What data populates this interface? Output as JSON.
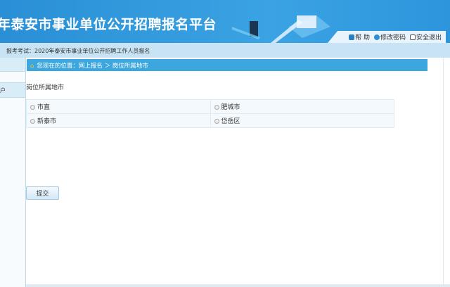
{
  "header": {
    "title": "年泰安市事业单位公开招聘报名平台",
    "links": [
      {
        "label": "帮 助",
        "icon": "lock-icon"
      },
      {
        "label": "修改密码",
        "icon": "help-icon"
      },
      {
        "label": "安全退出",
        "icon": "exit-icon"
      }
    ]
  },
  "exam": {
    "text": "报考考试：2020年泰安市事业单位公开招聘工作人员报名"
  },
  "sidebar": {
    "items": [
      {
        "label": ""
      },
      {
        "label": "户"
      }
    ]
  },
  "breadcrumb": {
    "text": "您现在的位置：网上报名 ＞ 岗位所属地市"
  },
  "form": {
    "title": "岗位所属地市",
    "options": [
      "市直",
      "肥城市",
      "新泰市",
      "岱岳区"
    ],
    "submit": "提交"
  }
}
